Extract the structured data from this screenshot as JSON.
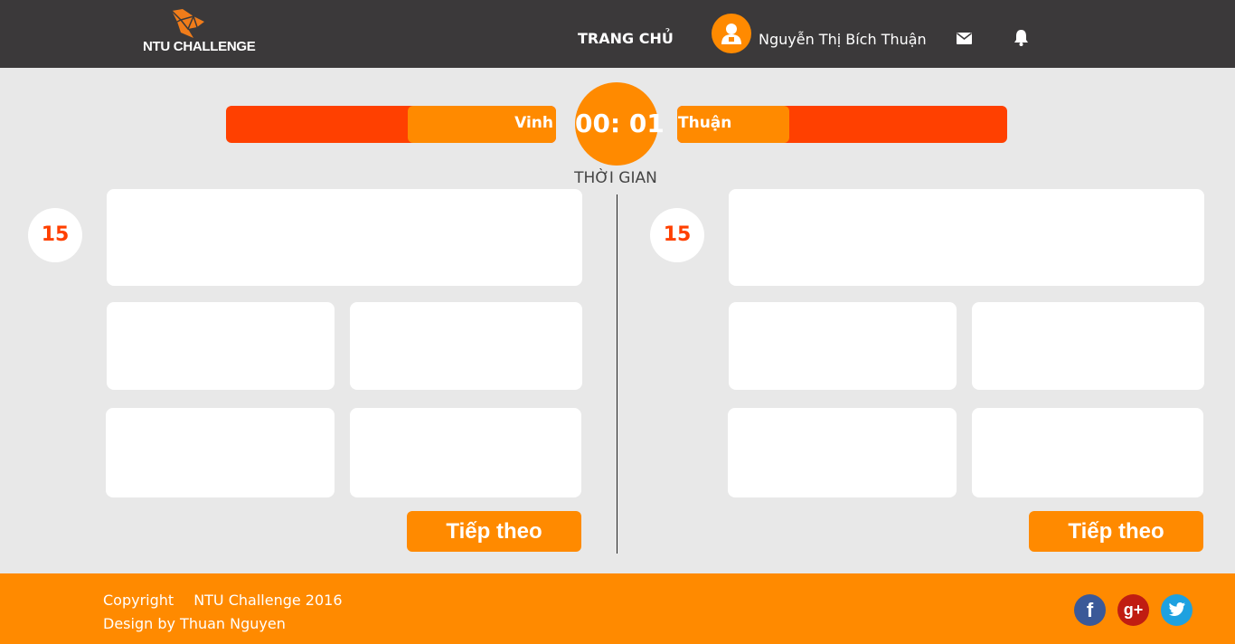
{
  "header": {
    "logo_text": "NTU CHALLENGE",
    "nav_home": "TRANG CHỦ",
    "user_name": "Nguyễn Thị Bích Thuận",
    "icons": [
      "user-avatar-icon",
      "mail-icon",
      "bell-icon"
    ]
  },
  "match": {
    "left_player": "Vinh",
    "right_player": "Thuận",
    "timer": "00: 01",
    "timer_label": "THỜI GIAN",
    "left_progress": 0.45,
    "right_progress": 0.34
  },
  "panels": {
    "left": {
      "question_number": "15",
      "next_label": "Tiếp theo"
    },
    "right": {
      "question_number": "15",
      "next_label": "Tiếp theo"
    }
  },
  "footer": {
    "copyright_label": "Copyright",
    "copyright_holder": "NTU Challenge 2016",
    "design_credit": "Design by Thuan Nguyen",
    "social": {
      "facebook": "f",
      "google": "g+",
      "twitter": "twitter-icon"
    }
  },
  "colors": {
    "header_bg": "#3b393a",
    "accent_orange": "#ff8a00",
    "accent_red": "#ff4000",
    "page_bg": "#e8e8e8"
  }
}
